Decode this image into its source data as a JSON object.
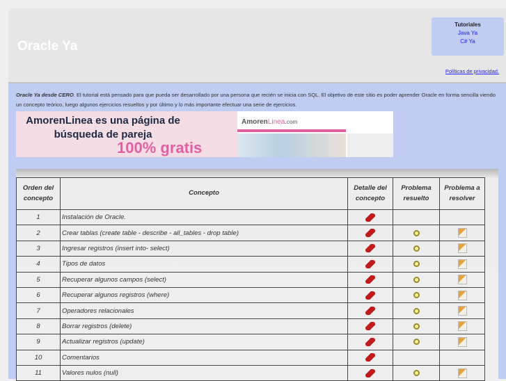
{
  "header": {
    "title": "Oracle Ya",
    "tutorials_heading": "Tutoriales",
    "tutorial_links": [
      "Java Ya",
      "C# Ya"
    ],
    "privacy_link": "Políticas de privacidad."
  },
  "intro": {
    "bold": "Oracle Ya desde CERO",
    "text": ". El tutorial está pensado para que pueda ser desarrollado por una persona que recién se inicia con SQL. El objetivo de este sitio es poder aprender Oracle en forma sencilla viendo un concepto teórico, luego algunos ejercicios resueltos y por último y lo más importante efectuar una serie de ejercicios."
  },
  "ad": {
    "line1": "AmorenLinea es una página de búsqueda de pareja",
    "line2": "100% gratis",
    "logo_a": "Amoren",
    "logo_b": "Linea",
    "logo_c": ".com"
  },
  "table": {
    "headers": [
      "Orden del concepto",
      "Concepto",
      "Detalle del concepto",
      "Problema resuelto",
      "Problema a resolver"
    ],
    "rows": [
      {
        "n": "1",
        "c": "Instalación de Oracle.",
        "solved": false,
        "todo": false
      },
      {
        "n": "2",
        "c": "Crear tablas (create table - describe - all_tables - drop table)",
        "solved": true,
        "todo": true
      },
      {
        "n": "3",
        "c": "Ingresar registros (insert into- select)",
        "solved": true,
        "todo": true
      },
      {
        "n": "4",
        "c": "Tipos de datos",
        "solved": true,
        "todo": true
      },
      {
        "n": "5",
        "c": "Recuperar algunos campos (select)",
        "solved": true,
        "todo": true
      },
      {
        "n": "6",
        "c": "Recuperar algunos registros (where)",
        "solved": true,
        "todo": true
      },
      {
        "n": "7",
        "c": "Operadores relacionales",
        "solved": true,
        "todo": true
      },
      {
        "n": "8",
        "c": "Borrar registros (delete)",
        "solved": true,
        "todo": true
      },
      {
        "n": "9",
        "c": "Actualizar registros (update)",
        "solved": true,
        "todo": true
      },
      {
        "n": "10",
        "c": "Comentarios",
        "solved": false,
        "todo": false
      },
      {
        "n": "11",
        "c": "Valores nulos (null)",
        "solved": true,
        "todo": true
      }
    ]
  }
}
